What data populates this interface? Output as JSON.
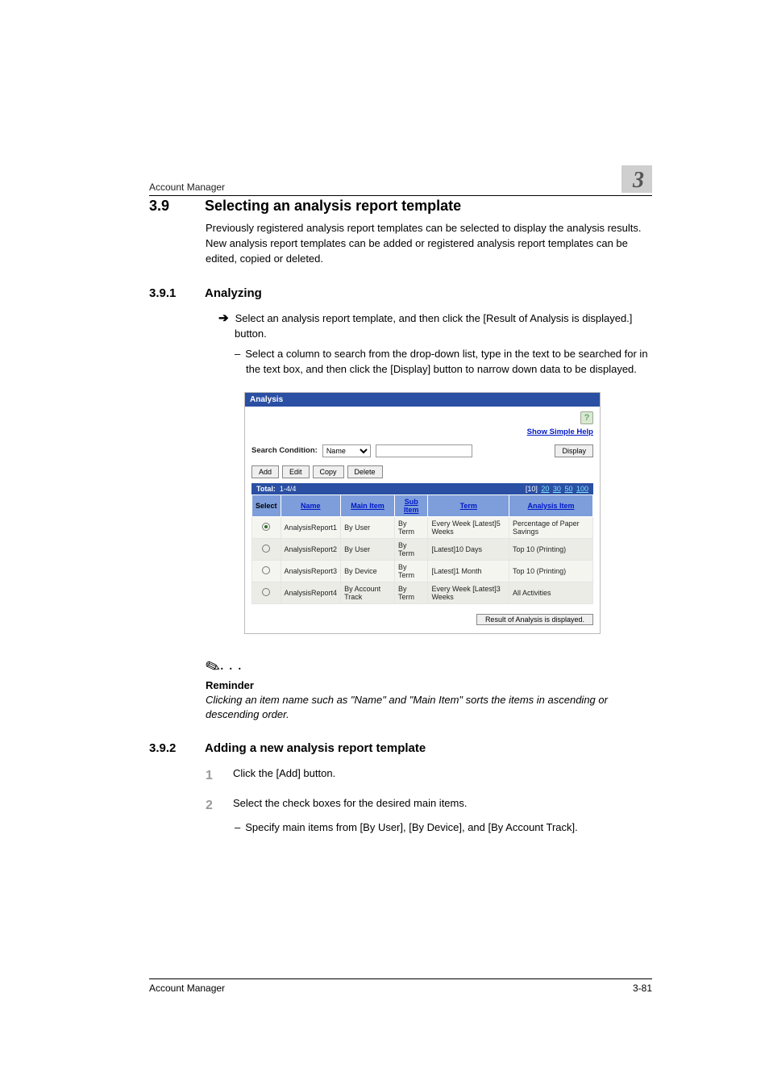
{
  "running": {
    "title": "Account Manager",
    "chapter": "3"
  },
  "sec": {
    "num": "3.9",
    "title": "Selecting an analysis report template",
    "intro": "Previously registered analysis report templates can be selected to display the analysis results. New analysis report templates can be added or registered analysis report templates can be edited, copied or deleted."
  },
  "sub1": {
    "num": "3.9.1",
    "title": "Analyzing",
    "arrow": "Select an analysis report template, and then click the [Result of Analysis is displayed.] button.",
    "dash": "Select a column to search from the drop-down list, type in the text to be searched for in the text box, and then click the [Display] button to narrow down data to be displayed."
  },
  "shot": {
    "title": "Analysis",
    "help": "Show Simple Help",
    "sc_label": "Search Condition:",
    "sc_option": "Name",
    "display": "Display",
    "btns": {
      "add": "Add",
      "edit": "Edit",
      "copy": "Copy",
      "del": "Delete"
    },
    "total_label": "Total:",
    "total_range": "1-4/4",
    "pager": {
      "cur": "[10]",
      "p20": "20",
      "p30": "30",
      "p50": "50",
      "p100": "100"
    },
    "cols": {
      "select": "Select",
      "name": "Name",
      "main": "Main Item",
      "sub": "Sub Item",
      "term": "Term",
      "analysis": "Analysis Item"
    },
    "rows": [
      {
        "sel": true,
        "name": "AnalysisReport1",
        "main": "By User",
        "sub": "By Term",
        "term": "Every Week [Latest]5 Weeks",
        "analysis": "Percentage of Paper Savings"
      },
      {
        "sel": false,
        "name": "AnalysisReport2",
        "main": "By User",
        "sub": "By Term",
        "term": "[Latest]10 Days",
        "analysis": "Top 10 (Printing)"
      },
      {
        "sel": false,
        "name": "AnalysisReport3",
        "main": "By Device",
        "sub": "By Term",
        "term": "[Latest]1 Month",
        "analysis": "Top 10 (Printing)"
      },
      {
        "sel": false,
        "name": "AnalysisReport4",
        "main": "By Account Track",
        "sub": "By Term",
        "term": "Every Week [Latest]3 Weeks",
        "analysis": "All Activities"
      }
    ],
    "result": "Result of Analysis is displayed."
  },
  "reminder": {
    "label": "Reminder",
    "text": "Clicking an item name such as \"Name\" and \"Main Item\" sorts the items in ascending or descending order."
  },
  "sub2": {
    "num": "3.9.2",
    "title": "Adding a new analysis report template",
    "step1": "Click the [Add] button.",
    "step2": "Select the check boxes for the desired main items.",
    "dash": "Specify main items from [By User], [By Device], and [By Account Track]."
  },
  "steps": {
    "n1": "1",
    "n2": "2"
  },
  "footer": {
    "left": "Account Manager",
    "right": "3-81"
  },
  "glyph": {
    "arrow": "➔",
    "dash": "–",
    "pen": "✎",
    "dots": ". . ."
  }
}
